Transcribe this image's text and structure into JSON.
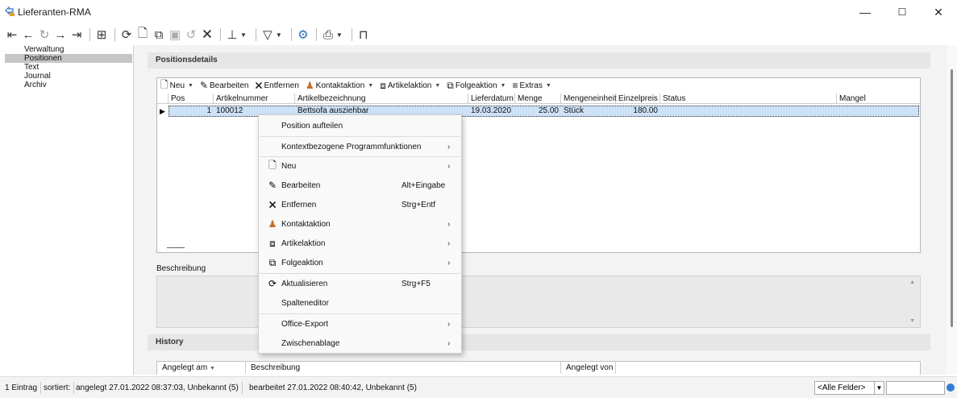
{
  "window": {
    "title": "Lieferanten-RMA",
    "minimize": "—",
    "maximize": "☐",
    "close": "✕"
  },
  "toolbar": {
    "icons": [
      "first-icon",
      "previous-icon",
      "history-icon",
      "next-icon",
      "last-icon",
      "table-icon",
      "refresh-icon",
      "new-icon",
      "copy-icon",
      "save-icon",
      "undo-icon",
      "delete-icon",
      "pin-icon",
      "filter-icon",
      "settings-icon",
      "print-icon",
      "layout-icon"
    ]
  },
  "nav": {
    "items": [
      {
        "label": "Verwaltung",
        "selected": false
      },
      {
        "label": "Positionen",
        "selected": true
      },
      {
        "label": "Text",
        "selected": false
      },
      {
        "label": "Journal",
        "selected": false
      },
      {
        "label": "Archiv",
        "selected": false
      }
    ]
  },
  "positions": {
    "header": "Positionsdetails",
    "toolbar": {
      "neu": "Neu",
      "bearbeiten": "Bearbeiten",
      "entfernen": "Entfernen",
      "kontaktaktion": "Kontaktaktion",
      "artikelaktion": "Artikelaktion",
      "folgeaktion": "Folgeaktion",
      "extras": "Extras"
    },
    "columns": [
      "Pos",
      "Artikelnummer",
      "Artikelbezeichnung",
      "Lieferdatum",
      "Menge",
      "Mengeneinheit",
      "Einzelpreis",
      "Status",
      "Mangel"
    ],
    "row": {
      "pos": "1",
      "artikelnummer": "100012",
      "artikelbezeichnung": "Bettsofa ausziehbar",
      "lieferdatum": "19.03.2020",
      "menge": "25.00",
      "mengeneinheit": "Stück",
      "einzelpreis": "180.00",
      "status": "",
      "mangel": ""
    }
  },
  "description": {
    "label": "Beschreibung"
  },
  "history": {
    "header": "History",
    "columns": [
      "Angelegt am",
      "Beschreibung",
      "Angelegt von"
    ]
  },
  "statusbar": {
    "count": "1 Eintrag",
    "sorted": "sortiert:",
    "created": "angelegt 27.01.2022 08:37:03, Unbekannt (5)",
    "edited": "bearbeitet 27.01.2022 08:40:42, Unbekannt (5)",
    "field_filter": "<Alle Felder>"
  },
  "context_menu": {
    "aufteilen": "Position aufteilen",
    "kontext": "Kontextbezogene Programmfunktionen",
    "neu": "Neu",
    "bearbeiten": "Bearbeiten",
    "bearbeiten_shortcut": "Alt+Eingabe",
    "entfernen": "Entfernen",
    "entfernen_shortcut": "Strg+Entf",
    "kontaktaktion": "Kontaktaktion",
    "artikelaktion": "Artikelaktion",
    "folgeaktion": "Folgeaktion",
    "aktualisieren": "Aktualisieren",
    "aktualisieren_shortcut": "Strg+F5",
    "spalteneditor": "Spalteneditor",
    "office_export": "Office-Export",
    "zwischenablage": "Zwischenablage"
  },
  "colors": {
    "selection": "#cde1f7",
    "nav_selected": "#c6c6c6",
    "panel_bg": "#f3f3f3",
    "accent": "#2f7fd6"
  }
}
